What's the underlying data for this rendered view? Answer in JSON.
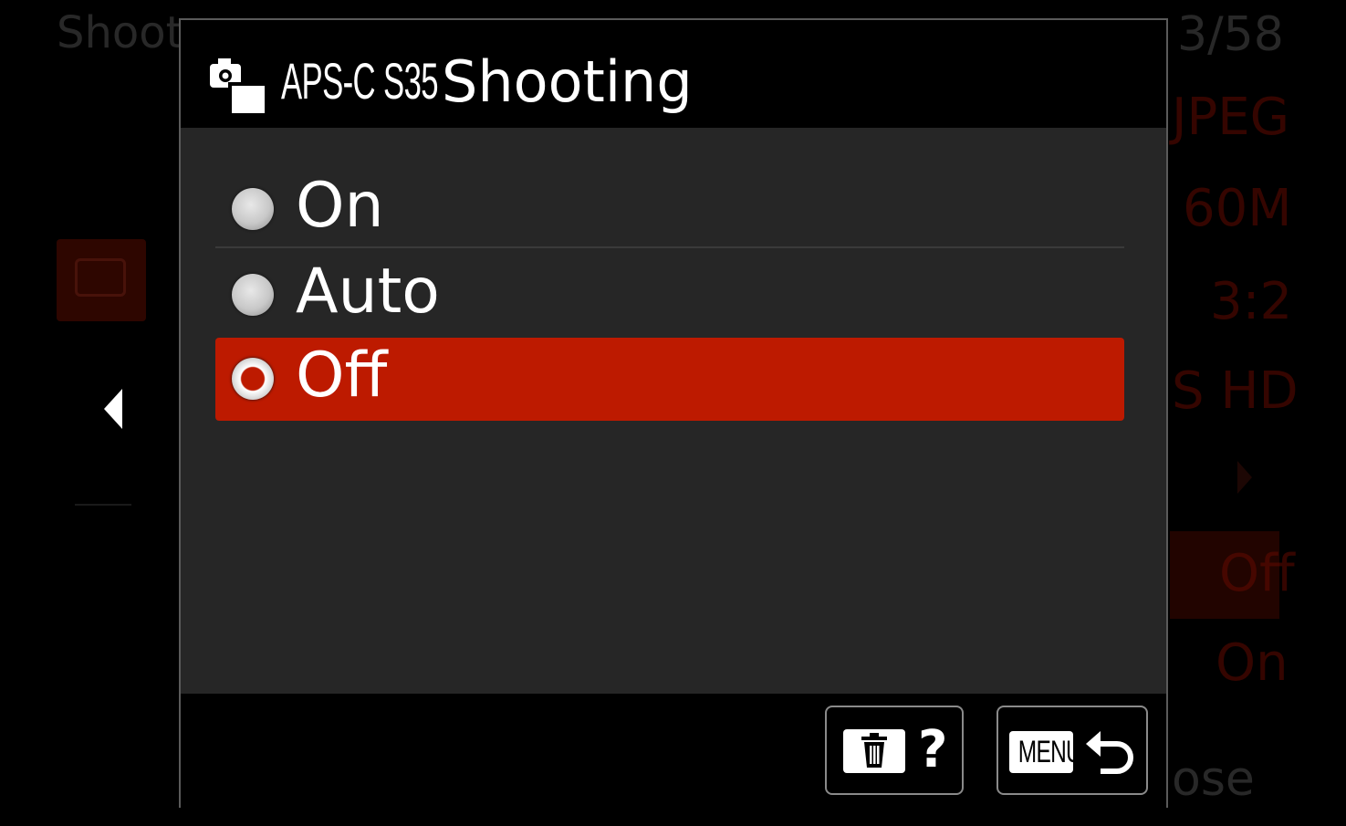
{
  "background_menu": {
    "title": "Shoot",
    "page": "3/58",
    "values": [
      "JPEG",
      "60M",
      "3:2",
      "S HD",
      "Off",
      "On"
    ],
    "footer": "ose"
  },
  "dialog": {
    "title_prefix": "APS-C S35",
    "title": "Shooting",
    "icon": "camera-aps-c-icon",
    "options": [
      {
        "label": "On",
        "selected": false
      },
      {
        "label": "Auto",
        "selected": false
      },
      {
        "label": "Off",
        "selected": true
      }
    ],
    "footer": {
      "delete_help_icon": "trash-icon",
      "help_label": "?",
      "menu_label": "MENU",
      "return_icon": "return-arrow-icon"
    }
  },
  "colors": {
    "selection": "#bd1a00",
    "panel": "#262626",
    "background": "#000000"
  }
}
